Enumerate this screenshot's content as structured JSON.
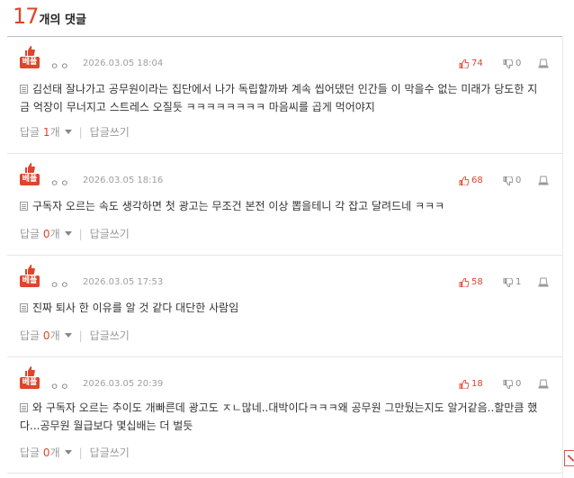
{
  "header": {
    "count": "17",
    "label": "개의 댓글"
  },
  "badge_label": "베플",
  "reply_label": "답글",
  "reply_unit": "개",
  "write_label": "답글쓰기",
  "comments": [
    {
      "author": "ㅇㅇ",
      "date": "2026.03.05 18:04",
      "likes": "74",
      "dislikes": "0",
      "text": "김선태 잘나가고 공무원이라는 집단에서 나가 독립할까봐 계속 씹어댔던 인간들 이 막을수 없는 미래가 당도한 지금 억장이 무너지고 스트레스 오질듯 ㅋㅋㅋㅋㅋㅋㅋㅋ 마음씨를 곱게 먹어야지",
      "reply_count": "1"
    },
    {
      "author": "ㅇㅇ",
      "date": "2026.03.05 18:16",
      "likes": "68",
      "dislikes": "0",
      "text": "구독자 오르는 속도 생각하면 첫 광고는 무조건 본전 이상 뽑을테니 각 잡고 달려드네 ㅋㅋㅋ",
      "reply_count": "0"
    },
    {
      "author": "ㅇㅇ",
      "date": "2026.03.05 17:53",
      "likes": "58",
      "dislikes": "1",
      "text": "진짜 퇴사 한 이유를 알 것 같다 대단한 사람임",
      "reply_count": "0"
    },
    {
      "author": "ㅇㅇ",
      "date": "2026.03.05 20:39",
      "likes": "18",
      "dislikes": "0",
      "text": "와 구독자 오르는 추이도 개빠른데 광고도 ㅈㄴ많네..대박이다ㅋㅋㅋ왜 공무원 그만뒀는지도 알거같음..할만큼 했다...공무원 월급보다 몇십배는 더 벌듯",
      "reply_count": "0"
    }
  ],
  "colors": {
    "accent": "#e0442b",
    "muted": "#999999"
  }
}
